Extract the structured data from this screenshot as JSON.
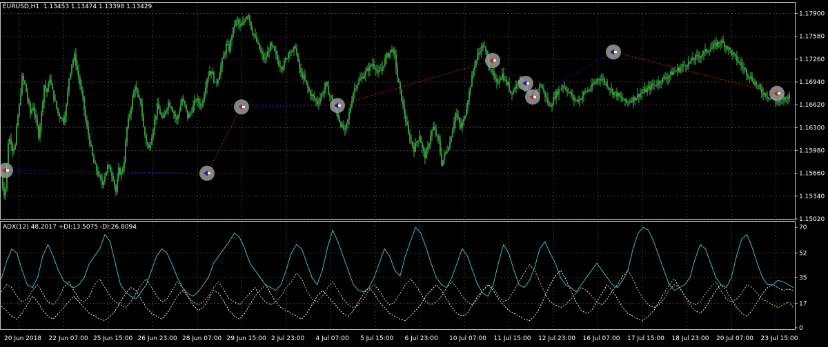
{
  "colors": {
    "background": "#000000",
    "grid": "#c0c0c0",
    "frame": "#c0c0c0",
    "candle": "#3fb84a",
    "adx": "#3fbfbf",
    "plus_di": "#d8d8a8",
    "minus_di": "#f5f5f5",
    "zigzag_up": "#1a1aa0",
    "zigzag_down": "#c02020",
    "signal_ring": "#9a9a9a",
    "axis_text": "#ffffff"
  },
  "price_panel": {
    "header": "EURUSD,H1  1.13453 1.13474 1.13398 1.13429"
  },
  "adx_panel": {
    "header": "ADX(12) 48.2017 +DI:13.5075 -DI:26.8094"
  },
  "chart_data": [
    {
      "type": "candlestick",
      "title": "",
      "symbol": "EURUSD,H1",
      "ohlc_last": {
        "open": 1.13453,
        "high": 1.13474,
        "low": 1.13398,
        "close": 1.13429
      },
      "y_ticks": [
        1.1502,
        1.1534,
        1.1566,
        1.1598,
        1.163,
        1.1662,
        1.1694,
        1.1726,
        1.1758,
        1.179
      ],
      "y_tick_labels": [
        "1.15020",
        "1.15340",
        "1.15660",
        "1.15980",
        "1.16300",
        "1.16620",
        "1.16940",
        "1.17260",
        "1.17580",
        "1.17900"
      ],
      "ylim": [
        1.1502,
        1.1805
      ],
      "grid": true,
      "price_path_index": [
        0,
        3,
        5,
        8,
        12,
        15,
        18,
        22,
        25,
        28,
        32,
        36,
        40,
        44,
        48,
        52,
        56,
        60,
        64,
        68,
        72,
        76,
        80,
        84,
        88,
        92,
        96,
        100,
        104,
        108,
        112,
        116,
        120,
        124,
        128,
        132,
        136,
        140,
        144,
        148,
        152,
        156,
        160,
        164,
        168,
        172,
        176,
        180,
        184,
        188,
        192,
        196,
        200,
        204,
        208,
        212,
        216,
        220,
        224,
        228,
        232,
        236,
        240,
        244,
        248,
        252,
        256,
        260,
        264,
        268,
        272,
        276,
        280,
        284,
        288,
        292,
        296,
        300,
        304,
        308,
        312,
        316,
        320,
        324,
        328,
        332,
        336,
        340,
        344,
        348,
        352,
        356,
        360,
        364,
        368,
        372,
        376,
        380,
        384,
        388,
        392,
        396,
        400,
        404,
        408,
        412,
        416,
        420,
        424,
        428,
        432,
        436,
        440,
        444,
        448,
        452,
        456,
        460,
        464,
        468,
        472,
        476,
        480,
        484,
        488,
        492,
        496,
        500,
        504,
        508,
        512,
        516,
        520,
        524,
        528,
        532,
        536,
        540,
        544,
        548,
        552,
        556,
        560,
        564,
        568,
        572,
        576,
        580,
        584,
        588,
        592,
        596,
        600,
        604,
        608,
        612,
        616,
        620,
        624,
        628,
        632,
        636,
        640,
        644,
        648,
        652,
        656,
        660,
        664,
        668,
        672,
        676,
        680,
        684,
        688,
        692,
        696,
        700,
        704,
        708,
        712,
        716,
        720,
        724,
        728,
        732,
        736,
        740,
        744,
        748,
        752,
        756,
        760,
        764,
        768,
        772,
        776,
        780,
        784,
        788,
        792,
        796,
        800,
        804,
        808,
        812,
        816,
        820,
        824,
        828,
        832,
        836,
        840,
        844,
        848,
        852,
        856,
        860,
        864,
        868,
        872,
        876,
        880,
        884,
        888,
        892,
        896,
        900,
        904,
        908,
        912,
        916,
        920,
        924,
        928,
        932,
        936,
        940,
        944,
        948,
        952,
        956,
        960,
        964,
        968,
        972,
        976,
        980,
        984,
        988,
        992,
        996,
        1000,
        1004,
        1008,
        1012,
        1016,
        1020,
        1024,
        1028,
        1032,
        1036,
        1040,
        1044,
        1048,
        1052,
        1056,
        1060,
        1064,
        1068,
        1072,
        1076,
        1080,
        1084,
        1088,
        1092,
        1096,
        1100,
        1104,
        1108,
        1112,
        1116,
        1120,
        1124,
        1128,
        1132,
        1136,
        1140,
        1144,
        1148,
        1152
      ],
      "price_path_close": [
        1.157,
        1.156,
        1.1535,
        1.1545,
        1.161,
        1.1615,
        1.16,
        1.1605,
        1.164,
        1.166,
        1.17,
        1.169,
        1.167,
        1.165,
        1.166,
        1.164,
        1.162,
        1.165,
        1.169,
        1.168,
        1.17,
        1.168,
        1.1665,
        1.165,
        1.1645,
        1.164,
        1.166,
        1.17,
        1.172,
        1.173,
        1.171,
        1.169,
        1.167,
        1.164,
        1.162,
        1.16,
        1.158,
        1.157,
        1.156,
        1.155,
        1.1565,
        1.1575,
        1.157,
        1.156,
        1.154,
        1.157,
        1.1565,
        1.1585,
        1.163,
        1.165,
        1.167,
        1.169,
        1.167,
        1.1665,
        1.163,
        1.161,
        1.16,
        1.162,
        1.164,
        1.166,
        1.165,
        1.164,
        1.1655,
        1.1665,
        1.166,
        1.165,
        1.164,
        1.1655,
        1.167,
        1.166,
        1.1645,
        1.165,
        1.166,
        1.167,
        1.1665,
        1.166,
        1.168,
        1.17,
        1.171,
        1.1705,
        1.169,
        1.17,
        1.1715,
        1.173,
        1.1745,
        1.174,
        1.176,
        1.1775,
        1.178,
        1.177,
        1.1775,
        1.1785,
        1.179,
        1.177,
        1.176,
        1.175,
        1.174,
        1.173,
        1.1725,
        1.1735,
        1.1745,
        1.174,
        1.173,
        1.172,
        1.1715,
        1.172,
        1.173,
        1.174,
        1.1735,
        1.1745,
        1.172,
        1.1705,
        1.17,
        1.169,
        1.168,
        1.1675,
        1.167,
        1.1665,
        1.1672,
        1.168,
        1.169,
        1.168,
        1.167,
        1.166,
        1.165,
        1.164,
        1.163,
        1.1625,
        1.164,
        1.166,
        1.168,
        1.169,
        1.1695,
        1.17,
        1.1705,
        1.171,
        1.1715,
        1.172,
        1.1715,
        1.1705,
        1.171,
        1.172,
        1.173,
        1.1735,
        1.174,
        1.173,
        1.17,
        1.168,
        1.166,
        1.164,
        1.162,
        1.161,
        1.16,
        1.161,
        1.162,
        1.16,
        1.159,
        1.16,
        1.162,
        1.163,
        1.162,
        1.161,
        1.158,
        1.159,
        1.16,
        1.161,
        1.163,
        1.165,
        1.164,
        1.163,
        1.164,
        1.166,
        1.168,
        1.17,
        1.172,
        1.173,
        1.174,
        1.1745,
        1.1735,
        1.172,
        1.171,
        1.17,
        1.169,
        1.17,
        1.1705,
        1.1695,
        1.169,
        1.168,
        1.1682,
        1.169,
        1.17,
        1.1695,
        1.169,
        1.168,
        1.167,
        1.1672,
        1.168,
        1.1685,
        1.169,
        1.168,
        1.167,
        1.166,
        1.1665,
        1.1675,
        1.168,
        1.1685,
        1.169,
        1.1685,
        1.168,
        1.1675,
        1.167,
        1.1668,
        1.167,
        1.1675,
        1.168,
        1.1682,
        1.1685,
        1.169,
        1.1695,
        1.17,
        1.1698,
        1.1695,
        1.169,
        1.1685,
        1.168,
        1.1678,
        1.1675,
        1.167,
        1.1668,
        1.1665,
        1.1668,
        1.167,
        1.1672,
        1.1675,
        1.1678,
        1.168,
        1.1682,
        1.1685,
        1.1688,
        1.169,
        1.1692,
        1.1695,
        1.1698,
        1.17,
        1.1702,
        1.1705,
        1.1708,
        1.171,
        1.1712,
        1.1715,
        1.1718,
        1.172,
        1.1722,
        1.1725,
        1.1728,
        1.173,
        1.1732,
        1.1735,
        1.1738,
        1.174,
        1.1742,
        1.1745,
        1.1748,
        1.175,
        1.1748,
        1.1745,
        1.174,
        1.1735,
        1.173,
        1.1725,
        1.172,
        1.1715,
        1.171,
        1.1705,
        1.17,
        1.1695,
        1.169,
        1.1685,
        1.168,
        1.1678,
        1.1675,
        1.1672,
        1.167,
        1.1668,
        1.1665,
        1.1668,
        1.167,
        1.1672,
        1.1675
      ],
      "zigzag": [
        {
          "i": 8,
          "price": 1.157,
          "dir": "down"
        },
        {
          "i": 300,
          "price": 1.1566,
          "dir": "up"
        },
        {
          "i": 350,
          "price": 1.1659,
          "dir": "down"
        },
        {
          "i": 489,
          "price": 1.1661,
          "dir": "up"
        },
        {
          "i": 714,
          "price": 1.1724,
          "dir": "down"
        },
        {
          "i": 762,
          "price": 1.1692,
          "dir": "up"
        },
        {
          "i": 772,
          "price": 1.1673,
          "dir": "down"
        },
        {
          "i": 889,
          "price": 1.1736,
          "dir": "up"
        },
        {
          "i": 1126,
          "price": 1.1678,
          "dir": "down"
        }
      ]
    },
    {
      "type": "line",
      "title": "ADX(12)",
      "y_ticks": [
        0,
        17,
        35,
        52,
        70
      ],
      "ylim": [
        0,
        72
      ],
      "x_tick_labels": [
        "20 Jun 2018",
        "22 Jun 07:00",
        "25 Jun 15:00",
        "26 Jun 23:00",
        "28 Jun 07:00",
        "29 Jun 15:00",
        "2 Jul 23:00",
        "4 Jul 07:00",
        "5 Jul 15:00",
        "6 Jul 23:00",
        "10 Jul 07:00",
        "11 Jul 15:00",
        "12 Jul 23:00",
        "16 Jul 07:00",
        "17 Jul 15:00",
        "18 Jul 23:00",
        "20 Jul 07:00",
        "23 Jul 15:00"
      ],
      "series": [
        {
          "name": "ADX",
          "values": [
            34,
            46,
            55,
            52,
            40,
            30,
            28,
            35,
            50,
            58,
            50,
            40,
            33,
            30,
            28,
            30,
            35,
            45,
            50,
            55,
            65,
            60,
            45,
            30,
            25,
            22,
            20,
            25,
            30,
            40,
            50,
            55,
            52,
            44,
            35,
            28,
            24,
            22,
            25,
            30,
            35,
            45,
            50,
            55,
            60,
            66,
            63,
            55,
            45,
            40,
            35,
            30,
            28,
            26,
            30,
            40,
            52,
            58,
            55,
            45,
            35,
            30,
            40,
            56,
            68,
            60,
            50,
            40,
            30,
            26,
            25,
            28,
            35,
            45,
            55,
            50,
            40,
            36,
            50,
            60,
            70,
            66,
            56,
            45,
            35,
            30,
            28,
            35,
            45,
            55,
            50,
            40,
            30,
            24,
            22,
            30,
            45,
            58,
            52,
            40,
            30,
            28,
            33,
            42,
            55,
            60,
            52,
            45,
            35,
            30,
            28,
            25,
            30,
            35,
            40,
            45,
            40,
            35,
            30,
            28,
            33,
            40,
            55,
            66,
            70,
            68,
            60,
            50,
            40,
            30,
            26,
            28,
            30,
            35,
            48,
            58,
            55,
            45,
            35,
            30,
            28,
            35,
            50,
            62,
            65,
            56,
            45,
            35,
            30,
            30,
            33,
            32,
            30,
            28
          ]
        },
        {
          "name": "+DI",
          "values": [
            25,
            30,
            28,
            22,
            18,
            20,
            26,
            30,
            24,
            18,
            16,
            20,
            28,
            32,
            26,
            20,
            18,
            22,
            30,
            34,
            28,
            22,
            18,
            16,
            14,
            18,
            24,
            30,
            34,
            28,
            22,
            18,
            20,
            26,
            32,
            28,
            22,
            18,
            16,
            18,
            22,
            28,
            32,
            26,
            20,
            18,
            16,
            20,
            24,
            28,
            22,
            18,
            16,
            18,
            22,
            28,
            32,
            38,
            34,
            26,
            20,
            18,
            22,
            28,
            32,
            26,
            20,
            16,
            14,
            16,
            20,
            26,
            30,
            26,
            20,
            16,
            18,
            24,
            30,
            34,
            30,
            24,
            18,
            16,
            18,
            22,
            28,
            32,
            28,
            22,
            18,
            16,
            20,
            26,
            30,
            28,
            22,
            18,
            20,
            26,
            32,
            38,
            44,
            40,
            32,
            24,
            18,
            16,
            14,
            16,
            20,
            24,
            28,
            26,
            22,
            18,
            16,
            20,
            26,
            30,
            36,
            40,
            34,
            26,
            20,
            16,
            14,
            16,
            20,
            26,
            30,
            28,
            22,
            18,
            16,
            18,
            24,
            28,
            32,
            26,
            20,
            18,
            20,
            24,
            30,
            28,
            24,
            20,
            18,
            16,
            14,
            16,
            18,
            14
          ]
        },
        {
          "name": "-DI",
          "values": [
            15,
            12,
            8,
            6,
            10,
            16,
            22,
            18,
            12,
            8,
            6,
            10,
            14,
            18,
            22,
            18,
            14,
            10,
            8,
            6,
            5,
            8,
            12,
            18,
            24,
            28,
            26,
            20,
            14,
            10,
            8,
            6,
            10,
            16,
            22,
            26,
            22,
            16,
            12,
            14,
            20,
            26,
            24,
            18,
            12,
            8,
            6,
            10,
            16,
            22,
            26,
            30,
            24,
            18,
            14,
            12,
            10,
            8,
            6,
            10,
            16,
            22,
            26,
            22,
            18,
            14,
            10,
            8,
            12,
            18,
            24,
            28,
            24,
            18,
            14,
            10,
            8,
            6,
            5,
            8,
            12,
            16,
            22,
            26,
            30,
            26,
            20,
            14,
            10,
            8,
            10,
            16,
            22,
            26,
            30,
            26,
            20,
            16,
            12,
            10,
            8,
            6,
            5,
            8,
            14,
            22,
            30,
            36,
            40,
            34,
            26,
            18,
            12,
            10,
            12,
            18,
            24,
            30,
            26,
            20,
            14,
            10,
            8,
            6,
            5,
            8,
            12,
            18,
            24,
            30,
            34,
            28,
            22,
            16,
            12,
            10,
            14,
            20,
            26,
            30,
            26,
            20,
            14,
            10,
            8,
            12,
            18,
            24,
            28,
            30,
            28,
            26,
            27,
            26
          ]
        }
      ]
    }
  ]
}
